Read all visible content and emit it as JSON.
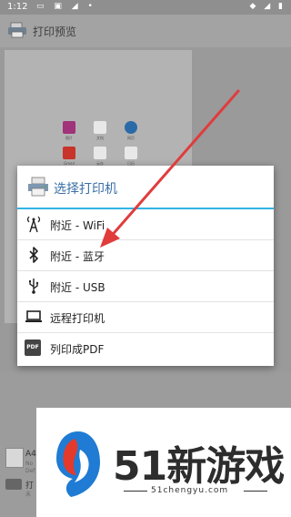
{
  "status_bar": {
    "time": "1:12",
    "left_icons": [
      "sim-icon",
      "photo-icon",
      "android-icon",
      "dot-icon"
    ],
    "right_icons": [
      "wifi-icon",
      "signal-icon",
      "battery-icon"
    ]
  },
  "app_bar": {
    "title": "打印预览",
    "icon": "printer-icon"
  },
  "preview": {
    "tiles": [
      {
        "label": "图片",
        "color": "#a0337a"
      },
      {
        "label": "文档",
        "color": "#e8e8e8"
      },
      {
        "label": "网页",
        "color": "#2b6aa8"
      },
      {
        "label": "Gmail",
        "color": "#c8332a"
      },
      {
        "label": "云存",
        "color": "#e8e8e8"
      },
      {
        "label": "日历",
        "color": "#e8e8e8"
      }
    ]
  },
  "lower": {
    "paper_label": "A4",
    "paper_sub": "No",
    "paper_sub2": "Def",
    "printer_label": "打",
    "printer_sub": "未"
  },
  "dialog": {
    "title": "选择打印机",
    "items": [
      {
        "label": "附近 - WiFi",
        "icon": "wifi-tower-icon"
      },
      {
        "label": "附近 - 蓝牙",
        "icon": "bluetooth-icon"
      },
      {
        "label": "附近 - USB",
        "icon": "usb-icon"
      },
      {
        "label": "远程打印机",
        "icon": "laptop-icon"
      },
      {
        "label": "列印成PDF",
        "icon": "pdf-icon",
        "icon_text": "PDF"
      }
    ]
  },
  "banner": {
    "brand": "51新游戏",
    "url": "51chengyu.com"
  },
  "colors": {
    "accent": "#33b5e5",
    "dialog_title": "#3a6fa6",
    "arrow": "#e03c3c"
  }
}
